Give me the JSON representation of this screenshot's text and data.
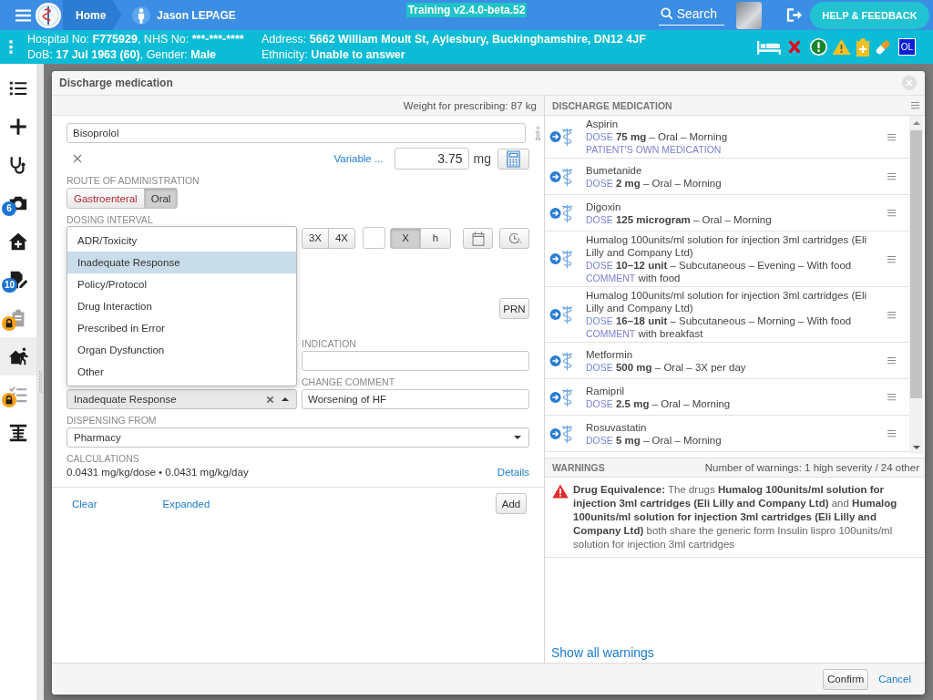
{
  "top_bar": {
    "breadcrumbs": [
      {
        "kind": "home",
        "label": "Home"
      },
      {
        "kind": "patient",
        "label": "Jason LEPAGE"
      }
    ],
    "version": "Training v2.4.0-beta.52",
    "search": "Search",
    "help_button": "HELP & FEEDBACK"
  },
  "patient_banner": {
    "lines": [
      [
        {
          "label": "Hospital No:",
          "value": "F775929"
        },
        {
          "label": ", NHS No:",
          "value": "***-***-****"
        }
      ],
      [
        {
          "label": "DoB:",
          "value": "17 Jul 1963 (60)"
        },
        {
          "label": ", Gender:",
          "value": "Male"
        }
      ],
      [
        {
          "label": "Address:",
          "value": "5662 William Moult St, Aylesbury, Buckinghamshire, DN12 4JF"
        }
      ],
      [
        {
          "label": "Ethnicity:",
          "value": "Unable to answer"
        }
      ]
    ],
    "status_badge": "OL"
  },
  "sidebar": {
    "items": [
      {
        "selected": false,
        "locked": false
      },
      {
        "selected": false,
        "locked": false
      },
      {
        "selected": false,
        "locked": false
      },
      {
        "selected": false,
        "locked": false,
        "badge": "6"
      },
      {
        "selected": false,
        "locked": false
      },
      {
        "selected": false,
        "locked": false,
        "badge": "10"
      },
      {
        "selected": false,
        "locked": true
      },
      {
        "selected": true,
        "locked": false
      },
      {
        "selected": false,
        "locked": true
      },
      {
        "selected": false,
        "locked": false
      }
    ]
  },
  "dialog": {
    "title": "Discharge medication",
    "weight": "Weight for prescribing: 87 kg",
    "form": {
      "drug": {
        "value": "Bisoprolol"
      },
      "variable_link": "Variable ...",
      "dose": {
        "value": "3.75",
        "unit": "mg"
      },
      "route": {
        "label": "ROUTE OF ADMINISTRATION",
        "options": [
          {
            "label": "Gastroenteral",
            "selected": false,
            "flagged": true
          },
          {
            "label": "Oral",
            "selected": true,
            "flagged": false
          }
        ]
      },
      "dosing_interval": {
        "label": "DOSING INTERVAL",
        "frequencies": [
          {
            "label": "3X",
            "selected": false
          },
          {
            "label": "4X",
            "selected": false
          }
        ],
        "units": [
          {
            "label": "X",
            "selected": true
          },
          {
            "label": "h",
            "selected": false
          }
        ]
      },
      "prn_button": {
        "label": "PRN",
        "selected": false
      },
      "indication": {
        "label": "INDICATION"
      },
      "change_reason": {
        "value": "Inadequate Response",
        "open": true,
        "options": [
          {
            "label": "ADR/Toxicity",
            "selected": false
          },
          {
            "label": "Inadequate Response",
            "selected": true
          },
          {
            "label": "Policy/Protocol",
            "selected": false
          },
          {
            "label": "Drug Interaction",
            "selected": false
          },
          {
            "label": "Prescribed in Error",
            "selected": false
          },
          {
            "label": "Organ Dysfunction",
            "selected": false
          },
          {
            "label": "Other",
            "selected": false
          }
        ]
      },
      "change_comment": {
        "label": "CHANGE COMMENT",
        "value": "Worsening of HF"
      },
      "dispensing": {
        "label": "DISPENSING FROM",
        "value": "Pharmacy"
      },
      "calculations": {
        "label": "CALCULATIONS",
        "text": "0.0431 mg/kg/dose • 0.0431 mg/kg/day",
        "link": "Details"
      },
      "actions": {
        "links": [
          "Clear",
          "Expanded"
        ],
        "button": "Add"
      }
    },
    "discharge_medication": {
      "title": "DISCHARGE MEDICATION",
      "items": [
        {
          "name": "Aspirin",
          "dose_label": "DOSE",
          "dose": "**75 mg** – Oral – Morning",
          "note": "PATIENT'S OWN MEDICATION"
        },
        {
          "name": "Bumetanide",
          "dose_label": "DOSE",
          "dose": "**2 mg** – Oral – Morning"
        },
        {
          "name": "Digoxin",
          "dose_label": "DOSE",
          "dose": "**125 microgram** – Oral – Morning"
        },
        {
          "name": "Humalog 100units/ml solution for injection 3ml cartridges (Eli Lilly and Company Ltd)",
          "dose_label": "DOSE",
          "dose": "**10–12 unit** – Subcutaneous – Evening – With food",
          "comment_label": "COMMENT",
          "comment": "with food"
        },
        {
          "name": "Humalog 100units/ml solution for injection 3ml cartridges (Eli Lilly and Company Ltd)",
          "dose_label": "DOSE",
          "dose": "**16–18 unit** – Subcutaneous – Morning – With food",
          "comment_label": "COMMENT",
          "comment": "with breakfast"
        },
        {
          "name": "Metformin",
          "dose_label": "DOSE",
          "dose": "**500 mg** – Oral – 3X per day"
        },
        {
          "name": "Ramipril",
          "dose_label": "DOSE",
          "dose": "**2.5 mg** – Oral – Morning"
        },
        {
          "name": "Rosuvastatin",
          "dose_label": "DOSE",
          "dose": "**5 mg** – Oral – Morning"
        }
      ]
    },
    "warnings": {
      "title": "WARNINGS",
      "summary": "Number of warnings: 1 high severity / 24 other",
      "items": [
        {
          "kind": "error",
          "text": "**Drug Equivalence:** The drugs **Humalog 100units/ml solution for injection 3ml cartridges (Eli Lilly and Company Ltd)** and **Humalog 100units/ml solution for injection 3ml cartridges (Eli Lilly and Company Ltd)** both share the generic form Insulin lispro 100units/ml solution for injection 3ml cartridges"
        }
      ],
      "show_all": "Show all warnings"
    },
    "footer": {
      "confirm": "Confirm",
      "cancel": "Cancel"
    }
  }
}
